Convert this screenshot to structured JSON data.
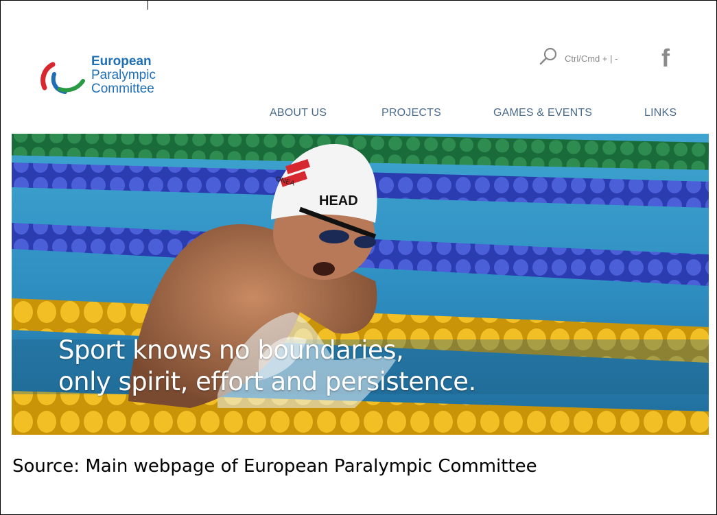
{
  "logo": {
    "line1": "European",
    "line2": "Paralympic",
    "line3": "Committee",
    "colors": {
      "red": "#d7282f",
      "blue": "#1f6fb5",
      "green": "#2a9a45"
    }
  },
  "utility": {
    "search_icon": "search-icon",
    "zoom_hint": "Ctrl/Cmd + | -",
    "social_icon": "facebook-icon",
    "social_glyph": "f"
  },
  "nav": {
    "items": [
      {
        "label": "ABOUT US"
      },
      {
        "label": "PROJECTS"
      },
      {
        "label": "GAMES & EVENTS"
      },
      {
        "label": "LINKS"
      }
    ]
  },
  "hero": {
    "caption_line1": "Sport knows no boundaries,",
    "caption_line2": "only spirit, effort and persistence.",
    "cap_text1": "ONEA",
    "cap_text2": "HEAD"
  },
  "source_note": "Source:  Main webpage of European Paralympic Committee"
}
